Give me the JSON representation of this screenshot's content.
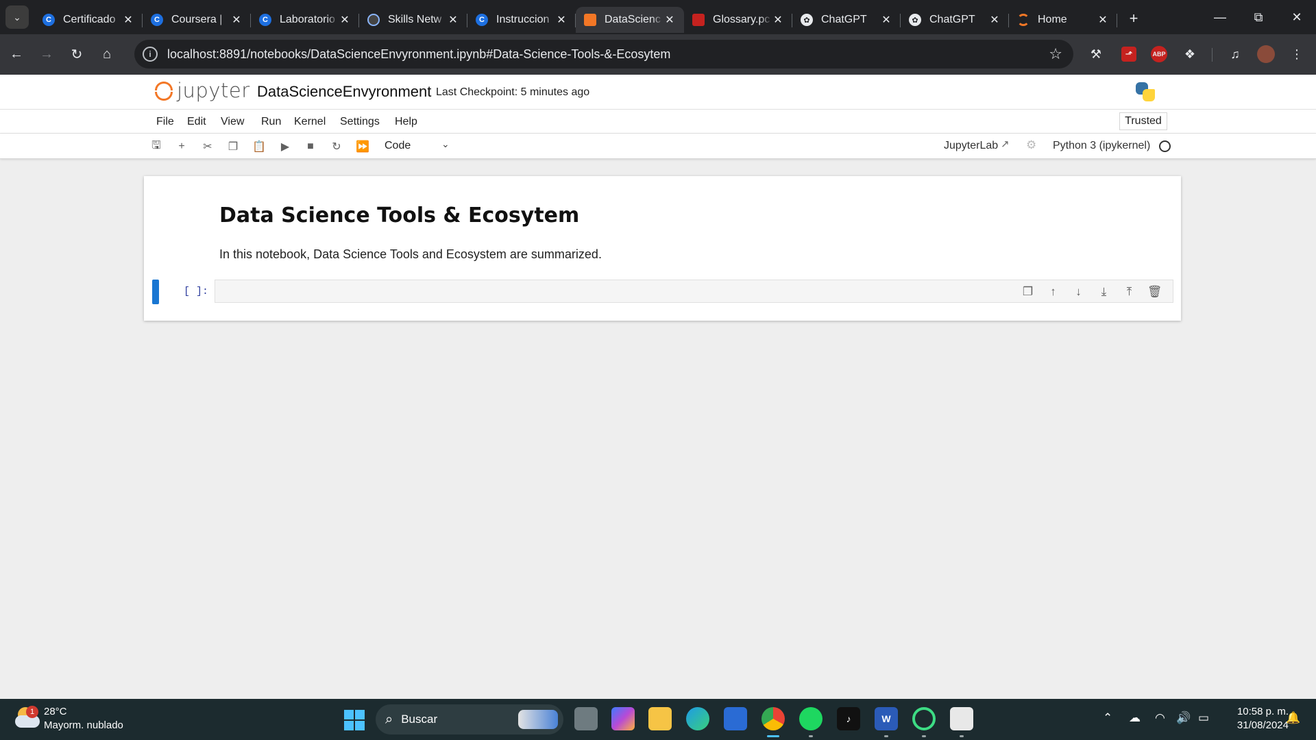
{
  "browser": {
    "tabs": [
      {
        "title": "Certificado",
        "favicon": "coursera-icon",
        "active": false
      },
      {
        "title": "Coursera |",
        "favicon": "coursera-icon",
        "active": false
      },
      {
        "title": "Laboratorio",
        "favicon": "coursera-icon",
        "active": false
      },
      {
        "title": "Skills Netw",
        "favicon": "skills-network-icon",
        "active": false
      },
      {
        "title": "Instruccion",
        "favicon": "coursera-icon",
        "active": false
      },
      {
        "title": "DataScienc",
        "favicon": "jupyter-icon",
        "active": true
      },
      {
        "title": "Glossary.pc",
        "favicon": "pdf-icon",
        "active": false
      },
      {
        "title": "ChatGPT",
        "favicon": "chatgpt-icon",
        "active": false
      },
      {
        "title": "ChatGPT",
        "favicon": "chatgpt-icon",
        "active": false
      },
      {
        "title": "Home",
        "favicon": "jupyter-home-icon",
        "active": false
      }
    ],
    "url": "localhost:8891/notebooks/DataScienceEnvyronment.ipynb#Data-Science-Tools-&-Ecosytem",
    "abp_label": "ABP"
  },
  "jupyter": {
    "logo_text": "jupyter",
    "notebook_name": "DataScienceEnvyronment",
    "checkpoint": "Last Checkpoint: 5 minutes ago",
    "menu": [
      "File",
      "Edit",
      "View",
      "Run",
      "Kernel",
      "Settings",
      "Help"
    ],
    "trusted": "Trusted",
    "cell_type": "Code",
    "jupyterlab_link": "JupyterLab",
    "kernel": "Python 3 (ipykernel)"
  },
  "notebook": {
    "heading": "Data Science Tools & Ecosytem",
    "paragraph": "In this notebook, Data Science Tools and Ecosystem are summarized.",
    "prompt": "[ ]:"
  },
  "taskbar": {
    "weather_badge": "1",
    "temperature": "28°C",
    "condition": "Mayorm. nublado",
    "search_placeholder": "Buscar",
    "word_label": "W",
    "time": "10:58 p. m.",
    "date": "31/08/2024"
  },
  "colors": {
    "accent_blue": "#1976d2",
    "jupyter_orange": "#f37726",
    "taskbar_bg": "#1c2b2f"
  }
}
